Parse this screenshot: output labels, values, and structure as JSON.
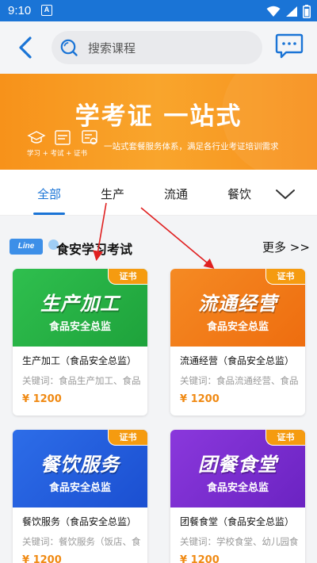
{
  "status": {
    "time": "9:10",
    "notify": "A"
  },
  "search": {
    "placeholder": "搜索课程"
  },
  "banner": {
    "title": "学考证  一站式",
    "flow": "学习  +  考试  +  证书",
    "desc": "一站式套餐服务体系，满足各行业考证培训需求"
  },
  "tabs": [
    {
      "label": "全部",
      "active": true
    },
    {
      "label": "生产",
      "active": false
    },
    {
      "label": "流通",
      "active": false
    },
    {
      "label": "餐饮",
      "active": false
    }
  ],
  "section": {
    "badge": "Line",
    "title": "食安学习考试",
    "more": "更多 >>"
  },
  "cards": [
    {
      "big": "生产加工",
      "sub": "食品安全总监",
      "tag": "证书",
      "name": "生产加工（食品安全总监）",
      "keywords": "关键词：食品生产加工、食品安全",
      "price": "¥ 1200",
      "color": "green"
    },
    {
      "big": "流通经营",
      "sub": "食品安全总监",
      "tag": "证书",
      "name": "流通经营（食品安全总监）",
      "keywords": "关键词：食品流通经营、食品安全",
      "price": "¥ 1200",
      "color": "orange"
    },
    {
      "big": "餐饮服务",
      "sub": "食品安全总监",
      "tag": "证书",
      "name": "餐饮服务（食品安全总监）",
      "keywords": "关键词：餐饮服务（饭店、食堂）",
      "price": "¥ 1200",
      "color": "blue"
    },
    {
      "big": "团餐食堂",
      "sub": "食品安全总监",
      "tag": "证书",
      "name": "团餐食堂（食品安全总监）",
      "keywords": "关键词：学校食堂、幼儿园食堂",
      "price": "¥ 1200",
      "color": "purple"
    }
  ],
  "colors": {
    "primary": "#1a74d6",
    "banner": "#f7921a",
    "price": "#f08a14",
    "annotation": "#e02020"
  }
}
